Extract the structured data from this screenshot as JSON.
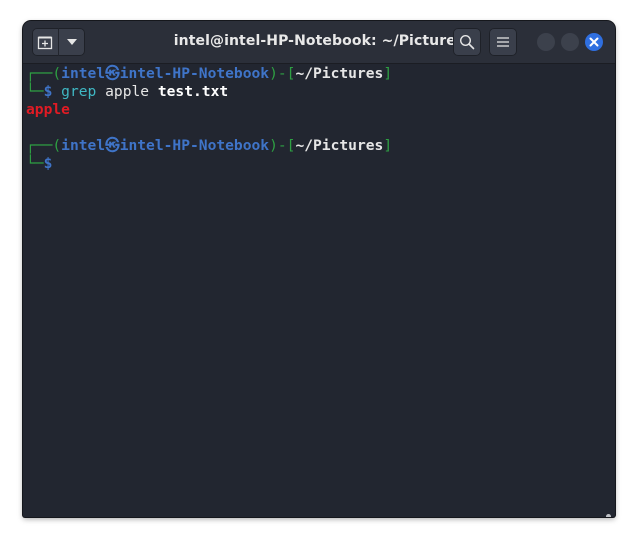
{
  "window": {
    "title": "intel@intel-HP-Notebook: ~/Pictures"
  },
  "icons": {
    "new_tab": "new-tab-icon",
    "menu_dropdown": "chevron-down-icon",
    "search": "search-icon",
    "hamburger": "hamburger-menu-icon",
    "minimize": "minimize-icon",
    "maximize": "maximize-icon",
    "close": "close-icon"
  },
  "colors": {
    "prompt_frame": "#2ea043",
    "user_host": "#3f74c8",
    "path": "#e6e6e6",
    "command": "#3fb8c4",
    "match": "#e01b24",
    "close_button": "#2f6fe0"
  },
  "terminal": {
    "prompt1": {
      "corner_open": "┌──(",
      "user": "intel",
      "at_symbol": "㉿",
      "host": "intel-HP-Notebook",
      "mid": ")-[",
      "path": "~/Pictures",
      "close_bracket": "]",
      "corner_close": "└─",
      "dollar": "$",
      "command": "grep",
      "arg1": "apple",
      "arg2": "test.txt"
    },
    "output": "apple",
    "prompt2": {
      "corner_open": "┌──(",
      "user": "intel",
      "at_symbol": "㉿",
      "host": "intel-HP-Notebook",
      "mid": ")-[",
      "path": "~/Pictures",
      "close_bracket": "]",
      "corner_close": "└─",
      "dollar": "$"
    }
  }
}
